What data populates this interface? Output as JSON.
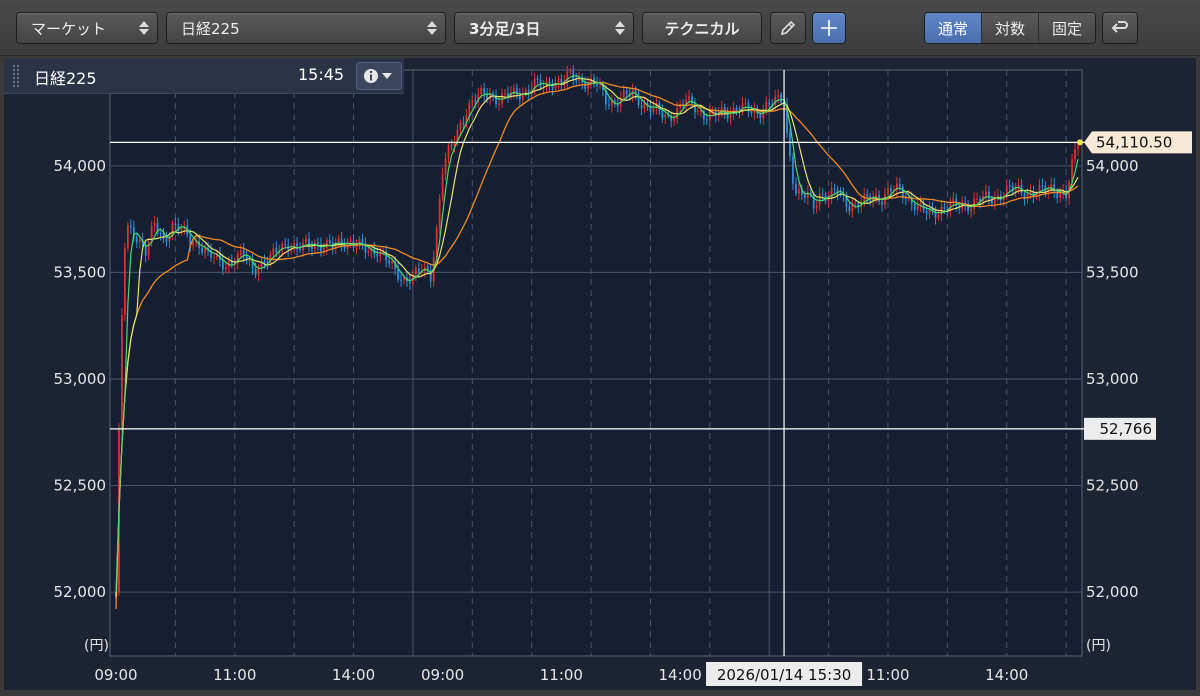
{
  "toolbar": {
    "market_select": "マーケット",
    "symbol_select": "日経225",
    "interval_select": "3分足/3日",
    "technical_button": "テクニカル",
    "scale_modes": [
      {
        "label": "通常",
        "active": true
      },
      {
        "label": "対数",
        "active": false
      },
      {
        "label": "固定",
        "active": false
      }
    ],
    "icons": [
      "pencil-icon",
      "crosshair-icon",
      "return-icon"
    ]
  },
  "info_bar": {
    "symbol": "日経225",
    "time": "15:45",
    "icons": [
      "info-icon",
      "dropdown-triangle-icon"
    ]
  },
  "chart_data": {
    "type": "candlestick",
    "title": "日経225",
    "unit_label": "(円)",
    "y_ticks": [
      "54,000",
      "53,500",
      "53,000",
      "52,500",
      "52,000"
    ],
    "y_tick_values": [
      54000,
      53500,
      53000,
      52500,
      52000
    ],
    "ylim": [
      51700,
      54450
    ],
    "x_tick_labels": [
      "09:00",
      "11:00",
      "14:00",
      "09:00",
      "11:00",
      "14:00",
      "11:00",
      "14:00"
    ],
    "x_tick_index": [
      0,
      40,
      80,
      110,
      150,
      190,
      260,
      300
    ],
    "n_bars": 325,
    "last_price_label": "54,110.50",
    "last_price": 54110.5,
    "ref_price_label": "52,766",
    "ref_price": 52766,
    "crosshair_label": "2026/01/14 15:30",
    "crosshair_index": 225,
    "colors": {
      "up": "#e0302f",
      "down": "#2f8fd8",
      "ma_short": "#4fd66a",
      "ma_mid": "#e8e36a",
      "ma_long": "#f08a24",
      "background": "#151f31",
      "grid": "#4a5568"
    },
    "series": [
      {
        "name": "close",
        "x": [
          0,
          1,
          2,
          3,
          4,
          6,
          8,
          10,
          13,
          16,
          19,
          22,
          25,
          28,
          31,
          34,
          37,
          40,
          43,
          46,
          49,
          52,
          55,
          58,
          61,
          64,
          67,
          70,
          73,
          76,
          79,
          82,
          85,
          88,
          91,
          94,
          97,
          100,
          103,
          106,
          108,
          109,
          110,
          111,
          112,
          114,
          116,
          118,
          120,
          123,
          126,
          129,
          132,
          135,
          138,
          141,
          144,
          147,
          150,
          153,
          156,
          159,
          162,
          165,
          168,
          171,
          174,
          177,
          180,
          183,
          186,
          189,
          192,
          195,
          198,
          201,
          204,
          207,
          210,
          213,
          216,
          219,
          222,
          225,
          226,
          227,
          228,
          229,
          231,
          233,
          235,
          237,
          240,
          243,
          246,
          249,
          252,
          255,
          258,
          261,
          264,
          267,
          270,
          273,
          276,
          279,
          282,
          285,
          288,
          291,
          294,
          297,
          300,
          303,
          306,
          309,
          312,
          315,
          318,
          320,
          322,
          324
        ],
        "y": [
          52000,
          52766,
          53300,
          53620,
          53700,
          53690,
          53650,
          53600,
          53720,
          53650,
          53720,
          53700,
          53650,
          53640,
          53580,
          53560,
          53540,
          53560,
          53580,
          53520,
          53540,
          53560,
          53620,
          53640,
          53600,
          53630,
          53640,
          53620,
          53620,
          53650,
          53640,
          53620,
          53600,
          53610,
          53560,
          53500,
          53470,
          53480,
          53510,
          53490,
          53700,
          53850,
          53980,
          54020,
          54060,
          54120,
          54200,
          54260,
          54300,
          54330,
          54340,
          54310,
          54330,
          54340,
          54350,
          54380,
          54370,
          54400,
          54390,
          54420,
          54410,
          54390,
          54380,
          54310,
          54300,
          54320,
          54340,
          54300,
          54270,
          54250,
          54230,
          54260,
          54300,
          54280,
          54240,
          54230,
          54250,
          54260,
          54270,
          54260,
          54250,
          54280,
          54300,
          54310,
          54150,
          54050,
          53950,
          53880,
          53850,
          53860,
          53820,
          53870,
          53850,
          53880,
          53830,
          53810,
          53830,
          53860,
          53850,
          53880,
          53890,
          53850,
          53800,
          53780,
          53790,
          53800,
          53810,
          53820,
          53820,
          53840,
          53850,
          53860,
          53880,
          53890,
          53880,
          53870,
          53880,
          53900,
          53880,
          53850,
          54000,
          54110.5
        ]
      }
    ],
    "grid": true
  }
}
